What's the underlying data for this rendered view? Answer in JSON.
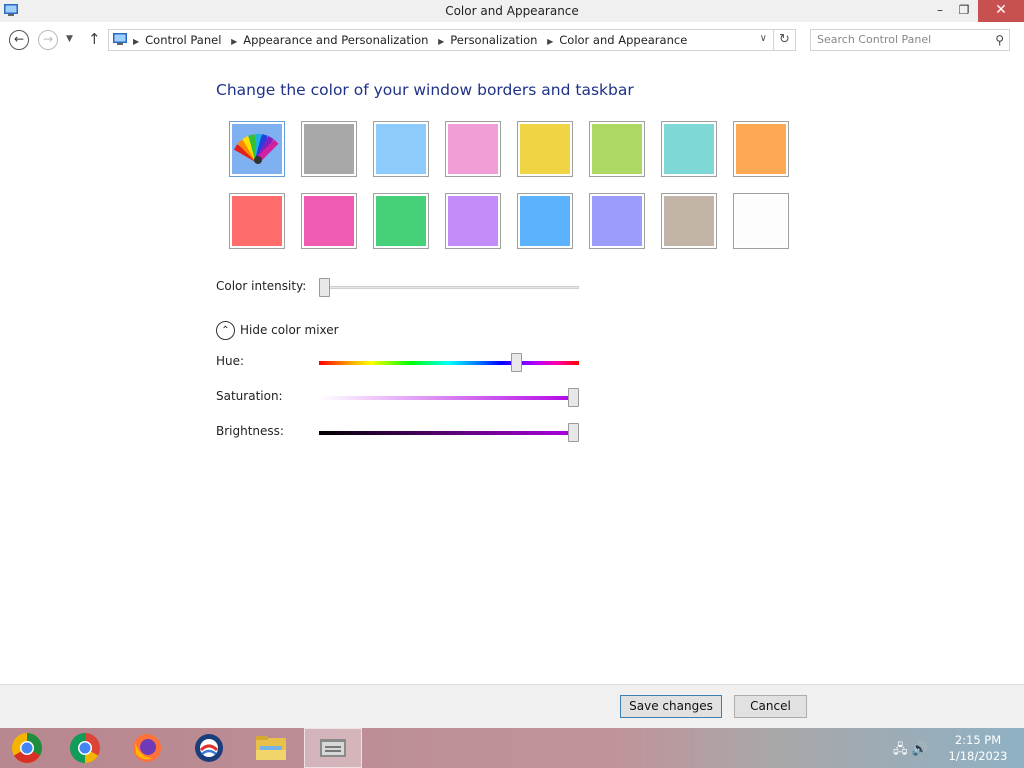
{
  "window": {
    "title": "Color and Appearance",
    "minimize": "–",
    "restore": "❐",
    "close": "✕"
  },
  "nav": {
    "back": "←",
    "forward": "→",
    "recent": "▼",
    "up": "↑",
    "breadcrumbs": [
      "Control Panel",
      "Appearance and Personalization",
      "Personalization",
      "Color and Appearance"
    ],
    "breadcrumb_separator": "▶",
    "dropdown": "∨",
    "refresh": "↻",
    "search_placeholder": "Search Control Panel",
    "search_icon": "⚲"
  },
  "main": {
    "heading": "Change the color of your window borders and taskbar",
    "swatches": [
      {
        "name": "automatic",
        "color": "#7fb1f0"
      },
      {
        "name": "gray",
        "color": "#a8a8a8"
      },
      {
        "name": "light-blue",
        "color": "#8ccbfc"
      },
      {
        "name": "pink",
        "color": "#f29ed6"
      },
      {
        "name": "yellow",
        "color": "#f0d443"
      },
      {
        "name": "lime",
        "color": "#aed864"
      },
      {
        "name": "teal",
        "color": "#7dd8d6"
      },
      {
        "name": "orange",
        "color": "#fda953"
      },
      {
        "name": "red",
        "color": "#fe6d6c"
      },
      {
        "name": "magenta",
        "color": "#f15ab2"
      },
      {
        "name": "green",
        "color": "#46d07a"
      },
      {
        "name": "purple",
        "color": "#c38cfa"
      },
      {
        "name": "blue",
        "color": "#5bb2fd"
      },
      {
        "name": "periwinkle",
        "color": "#9c9cfc"
      },
      {
        "name": "taupe",
        "color": "#c2b4a7"
      },
      {
        "name": "white",
        "color": "#fdfdfd"
      }
    ],
    "intensity_label": "Color intensity:",
    "mixer_toggle_icon": "⌃",
    "mixer_toggle_label": "Hide color mixer",
    "hue_label": "Hue:",
    "saturation_label": "Saturation:",
    "brightness_label": "Brightness:",
    "intensity_value": 0,
    "hue_value": 0.77,
    "saturation_value": 1.0,
    "brightness_value": 1.0
  },
  "footer": {
    "save": "Save changes",
    "cancel": "Cancel"
  },
  "taskbar": {
    "apps": [
      "chrome-canary",
      "chrome",
      "firefox",
      "opera-browser",
      "file-explorer",
      "control-panel"
    ],
    "time": "2:15 PM",
    "date": "1/18/2023"
  }
}
